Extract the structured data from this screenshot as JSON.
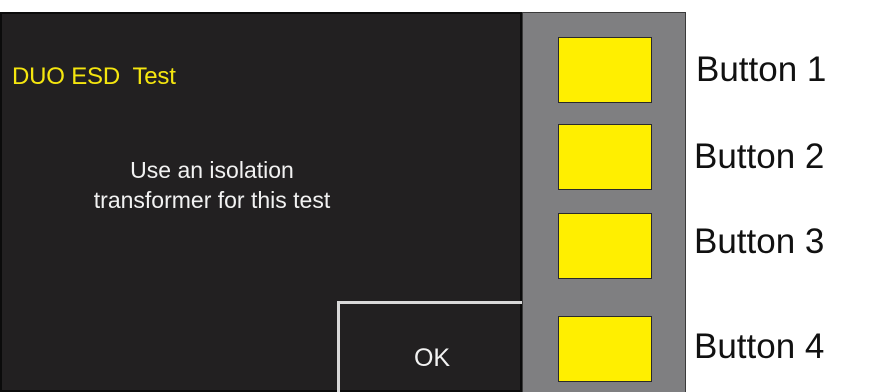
{
  "screen": {
    "title": "DUO ESD  Test",
    "message_line1": "Use an isolation",
    "message_line2": "transformer for this test",
    "ok_label": "OK"
  },
  "hardware_buttons": [
    {
      "label": "Button 1"
    },
    {
      "label": "Button 2"
    },
    {
      "label": "Button 3"
    },
    {
      "label": "Button 4"
    }
  ],
  "colors": {
    "screen_background": "#222021",
    "title_text": "#f5e60f",
    "message_text": "#f2f2f2",
    "bezel": "#7f7f81",
    "hardware_button": "#ffef00"
  }
}
